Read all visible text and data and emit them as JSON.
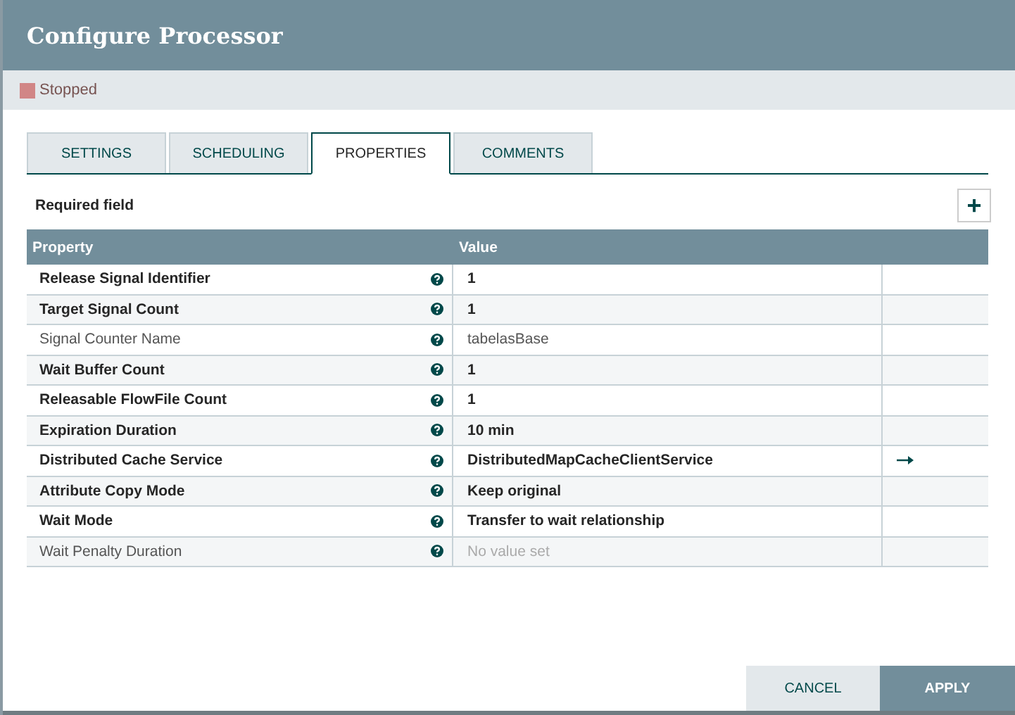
{
  "window": {
    "title": "Configure Processor"
  },
  "status": {
    "label": "Stopped",
    "color": "#d18686"
  },
  "tabs": [
    {
      "label": "SETTINGS",
      "selected": false
    },
    {
      "label": "SCHEDULING",
      "selected": false
    },
    {
      "label": "PROPERTIES",
      "selected": true
    },
    {
      "label": "COMMENTS",
      "selected": false
    }
  ],
  "required_note": "Required field",
  "add_button": {
    "label": "+"
  },
  "table": {
    "columns": [
      "Property",
      "Value"
    ],
    "rows": [
      {
        "property": "Release Signal Identifier",
        "required": true,
        "value": "1",
        "empty": false,
        "has_link": false
      },
      {
        "property": "Target Signal Count",
        "required": true,
        "value": "1",
        "empty": false,
        "has_link": false
      },
      {
        "property": "Signal Counter Name",
        "required": false,
        "value": "tabelasBase",
        "empty": false,
        "has_link": false
      },
      {
        "property": "Wait Buffer Count",
        "required": true,
        "value": "1",
        "empty": false,
        "has_link": false
      },
      {
        "property": "Releasable FlowFile Count",
        "required": true,
        "value": "1",
        "empty": false,
        "has_link": false
      },
      {
        "property": "Expiration Duration",
        "required": true,
        "value": "10 min",
        "empty": false,
        "has_link": false
      },
      {
        "property": "Distributed Cache Service",
        "required": true,
        "value": "DistributedMapCacheClientService",
        "empty": false,
        "has_link": true
      },
      {
        "property": "Attribute Copy Mode",
        "required": true,
        "value": "Keep original",
        "empty": false,
        "has_link": false
      },
      {
        "property": "Wait Mode",
        "required": true,
        "value": "Transfer to wait relationship",
        "empty": false,
        "has_link": false
      },
      {
        "property": "Wait Penalty Duration",
        "required": false,
        "value": "No value set",
        "empty": true,
        "has_link": false
      }
    ]
  },
  "buttons": [
    {
      "label": "CANCEL",
      "kind": "secondary"
    },
    {
      "label": "APPLY",
      "kind": "primary"
    }
  ]
}
